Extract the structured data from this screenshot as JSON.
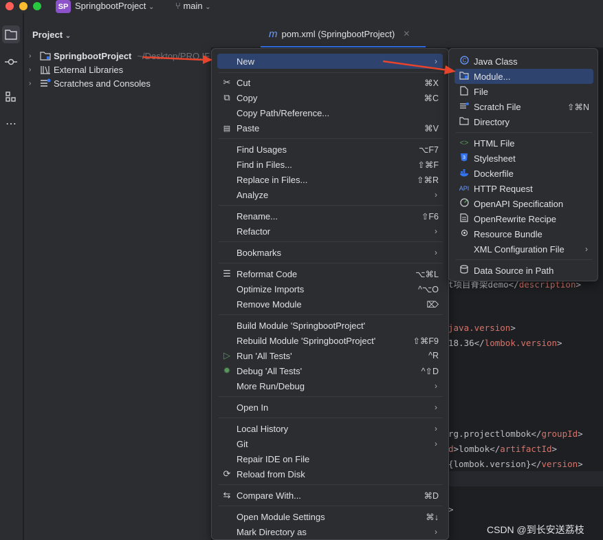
{
  "titlebar": {
    "project_badge": "SP",
    "project_name": "SpringbootProject",
    "branch": "main",
    "traffic_colors": [
      "#ff5f57",
      "#febc2e",
      "#28c840"
    ]
  },
  "project_panel": {
    "header": "Project",
    "tree": [
      {
        "label": "SpringbootProject",
        "path": "~/Desktop/PRO.IF",
        "icon": "module-folder-icon",
        "bold": true
      },
      {
        "label": "External Libraries",
        "icon": "library-icon",
        "bold": false
      },
      {
        "label": "Scratches and Consoles",
        "icon": "scratches-icon",
        "bold": false
      }
    ]
  },
  "editor": {
    "tab_icon": "m",
    "tab_label": "pom.xml (SpringbootProject)",
    "code": [
      {
        "pre": "",
        "tag": "",
        "text": "t项目脊架demo</",
        "tag2": "description",
        "post": ">"
      },
      {
        "pre": "",
        "tag": "java.version",
        "text": "",
        "tag2": "",
        "post": ">"
      },
      {
        "pre": "",
        "tag": "",
        "text": "18.36</",
        "tag2": "lombok.version",
        "post": ">"
      },
      {
        "pre": "",
        "tag": "",
        "text": "rg.projectlombok</",
        "tag2": "groupId",
        "post": ">"
      },
      {
        "pre": "",
        "tag": "d",
        "text": ">lombok</",
        "tag2": "artifactId",
        "post": ">"
      },
      {
        "pre": "",
        "tag": "",
        "text": "{lombok.version}</",
        "tag2": "version",
        "post": ">"
      },
      {
        "pre": "",
        "tag": "",
        "text": ">",
        "tag2": "",
        "post": ""
      }
    ]
  },
  "context_menu": {
    "items": [
      {
        "label": "New",
        "shortcut": "",
        "submenu": true,
        "icon": "",
        "highlight": true
      },
      {
        "label": "Cut",
        "shortcut": "⌘X",
        "submenu": false,
        "icon": "✂"
      },
      {
        "label": "Copy",
        "shortcut": "⌘C",
        "submenu": false,
        "icon": "⧉"
      },
      {
        "label": "Copy Path/Reference...",
        "shortcut": "",
        "submenu": false,
        "icon": ""
      },
      {
        "label": "Paste",
        "shortcut": "⌘V",
        "submenu": false,
        "icon": "📋"
      },
      {
        "label": "Find Usages",
        "shortcut": "⌥F7",
        "submenu": false,
        "icon": ""
      },
      {
        "label": "Find in Files...",
        "shortcut": "⇧⌘F",
        "submenu": false,
        "icon": ""
      },
      {
        "label": "Replace in Files...",
        "shortcut": "⇧⌘R",
        "submenu": false,
        "icon": ""
      },
      {
        "label": "Analyze",
        "shortcut": "",
        "submenu": true,
        "icon": ""
      },
      {
        "label": "Rename...",
        "shortcut": "⇧F6",
        "submenu": false,
        "icon": ""
      },
      {
        "label": "Refactor",
        "shortcut": "",
        "submenu": true,
        "icon": ""
      },
      {
        "label": "Bookmarks",
        "shortcut": "",
        "submenu": true,
        "icon": ""
      },
      {
        "label": "Reformat Code",
        "shortcut": "⌥⌘L",
        "submenu": false,
        "icon": "☰"
      },
      {
        "label": "Optimize Imports",
        "shortcut": "^⌥O",
        "submenu": false,
        "icon": ""
      },
      {
        "label": "Remove Module",
        "shortcut": "⌦",
        "submenu": false,
        "icon": ""
      },
      {
        "label": "Build Module 'SpringbootProject'",
        "shortcut": "",
        "submenu": false,
        "icon": ""
      },
      {
        "label": "Rebuild Module 'SpringbootProject'",
        "shortcut": "⇧⌘F9",
        "submenu": false,
        "icon": ""
      },
      {
        "label": "Run 'All Tests'",
        "shortcut": "^R",
        "submenu": false,
        "icon": "▷"
      },
      {
        "label": "Debug 'All Tests'",
        "shortcut": "^⇧D",
        "submenu": false,
        "icon": "✹"
      },
      {
        "label": "More Run/Debug",
        "shortcut": "",
        "submenu": true,
        "icon": ""
      },
      {
        "label": "Open In",
        "shortcut": "",
        "submenu": true,
        "icon": ""
      },
      {
        "label": "Local History",
        "shortcut": "",
        "submenu": true,
        "icon": ""
      },
      {
        "label": "Git",
        "shortcut": "",
        "submenu": true,
        "icon": ""
      },
      {
        "label": "Repair IDE on File",
        "shortcut": "",
        "submenu": false,
        "icon": ""
      },
      {
        "label": "Reload from Disk",
        "shortcut": "",
        "submenu": false,
        "icon": "⟳"
      },
      {
        "label": "Compare With...",
        "shortcut": "⌘D",
        "submenu": false,
        "icon": "⇆"
      },
      {
        "label": "Open Module Settings",
        "shortcut": "⌘↓",
        "submenu": false,
        "icon": ""
      },
      {
        "label": "Mark Directory as",
        "shortcut": "",
        "submenu": true,
        "icon": ""
      }
    ]
  },
  "new_submenu": {
    "items": [
      {
        "label": "Java Class",
        "shortcut": "",
        "submenu": false,
        "icon": "java-class-icon"
      },
      {
        "label": "Module...",
        "shortcut": "",
        "submenu": false,
        "icon": "module-icon",
        "highlight": true
      },
      {
        "label": "File",
        "shortcut": "",
        "submenu": false,
        "icon": "file-icon"
      },
      {
        "label": "Scratch File",
        "shortcut": "⇧⌘N",
        "submenu": false,
        "icon": "scratch-file-icon"
      },
      {
        "label": "Directory",
        "shortcut": "",
        "submenu": false,
        "icon": "directory-icon"
      },
      {
        "label": "HTML File",
        "shortcut": "",
        "submenu": false,
        "icon": "html-icon"
      },
      {
        "label": "Stylesheet",
        "shortcut": "",
        "submenu": false,
        "icon": "css-icon"
      },
      {
        "label": "Dockerfile",
        "shortcut": "",
        "submenu": false,
        "icon": "docker-icon"
      },
      {
        "label": "HTTP Request",
        "shortcut": "",
        "submenu": false,
        "icon": "api-icon"
      },
      {
        "label": "OpenAPI Specification",
        "shortcut": "",
        "submenu": false,
        "icon": "openapi-icon"
      },
      {
        "label": "OpenRewrite Recipe",
        "shortcut": "",
        "submenu": false,
        "icon": "openrewrite-icon"
      },
      {
        "label": "Resource Bundle",
        "shortcut": "",
        "submenu": false,
        "icon": "resource-bundle-icon"
      },
      {
        "label": "XML Configuration File",
        "shortcut": "",
        "submenu": true,
        "icon": ""
      },
      {
        "label": "Data Source in Path",
        "shortcut": "",
        "submenu": false,
        "icon": "database-icon"
      }
    ]
  },
  "watermark": "CSDN @到长安送荔枝",
  "colors": {
    "accent": "#3574f0",
    "highlight": "#2e436e",
    "arrow": "#e8442c"
  }
}
